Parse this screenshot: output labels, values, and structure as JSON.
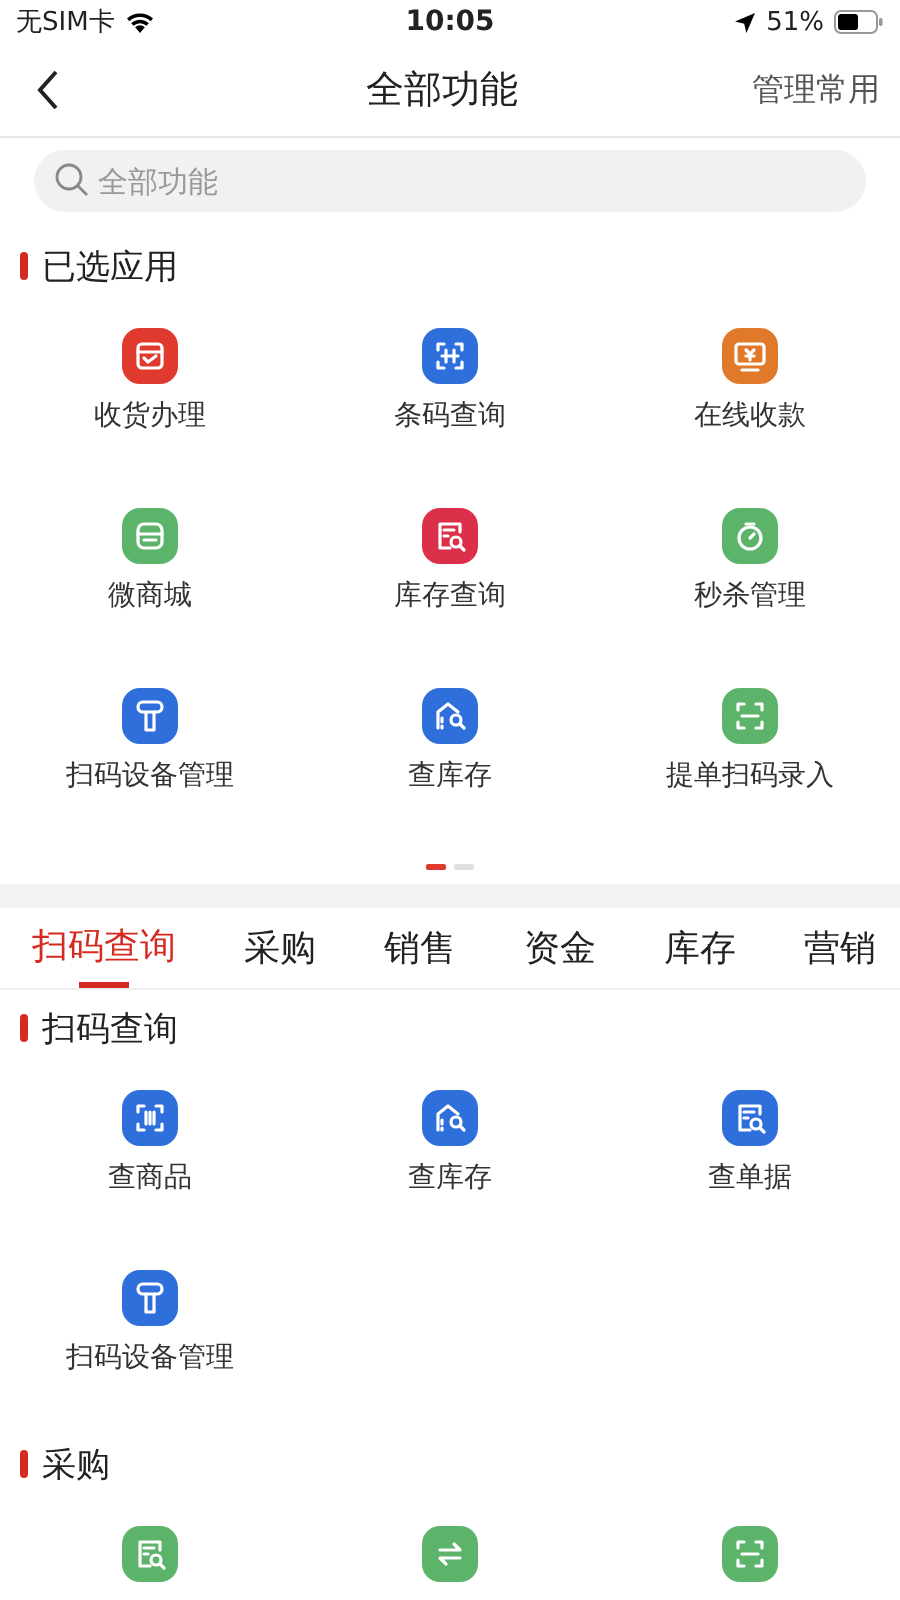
{
  "status_bar": {
    "carrier": "无SIM卡",
    "time": "10:05",
    "battery": "51%"
  },
  "nav": {
    "title": "全部功能",
    "action": "管理常用"
  },
  "search": {
    "placeholder": "全部功能"
  },
  "selected_apps": {
    "title": "已选应用",
    "items": [
      {
        "label": "收货办理",
        "kind": "package",
        "color": "#e03a2e"
      },
      {
        "label": "条码查询",
        "kind": "scan",
        "color": "#2f6fdc"
      },
      {
        "label": "在线收款",
        "kind": "monitor",
        "color": "#e07a2a"
      },
      {
        "label": "微商城",
        "kind": "store",
        "color": "#5cb36a"
      },
      {
        "label": "库存查询",
        "kind": "doc-search",
        "color": "#db2f4a"
      },
      {
        "label": "秒杀管理",
        "kind": "stopwatch",
        "color": "#5cb36a"
      },
      {
        "label": "扫码设备管理",
        "kind": "scanner",
        "color": "#2f6fdc"
      },
      {
        "label": "查库存",
        "kind": "house-search",
        "color": "#2f6fdc"
      },
      {
        "label": "提单扫码录入",
        "kind": "frame",
        "color": "#5cb36a"
      }
    ],
    "pager": [
      {
        "selected": true
      },
      {
        "selected": false
      }
    ]
  },
  "tabs": [
    {
      "label": "扫码查询",
      "selected": true
    },
    {
      "label": "采购",
      "selected": false
    },
    {
      "label": "销售",
      "selected": false
    },
    {
      "label": "资金",
      "selected": false
    },
    {
      "label": "库存",
      "selected": false
    },
    {
      "label": "营销",
      "selected": false
    }
  ],
  "sections": [
    {
      "title": "扫码查询",
      "items": [
        {
          "label": "查商品",
          "kind": "barcode",
          "color": "#2f6fdc"
        },
        {
          "label": "查库存",
          "kind": "house-search",
          "color": "#2f6fdc"
        },
        {
          "label": "查单据",
          "kind": "doc-search",
          "color": "#2f6fdc"
        },
        {
          "label": "扫码设备管理",
          "kind": "scanner",
          "color": "#2f6fdc"
        }
      ]
    },
    {
      "title": "采购",
      "items": [
        {
          "kind": "doc-search",
          "color": "#5cb36a"
        },
        {
          "kind": "exchange",
          "color": "#5cb36a"
        },
        {
          "kind": "frame",
          "color": "#5cb36a"
        }
      ]
    }
  ]
}
